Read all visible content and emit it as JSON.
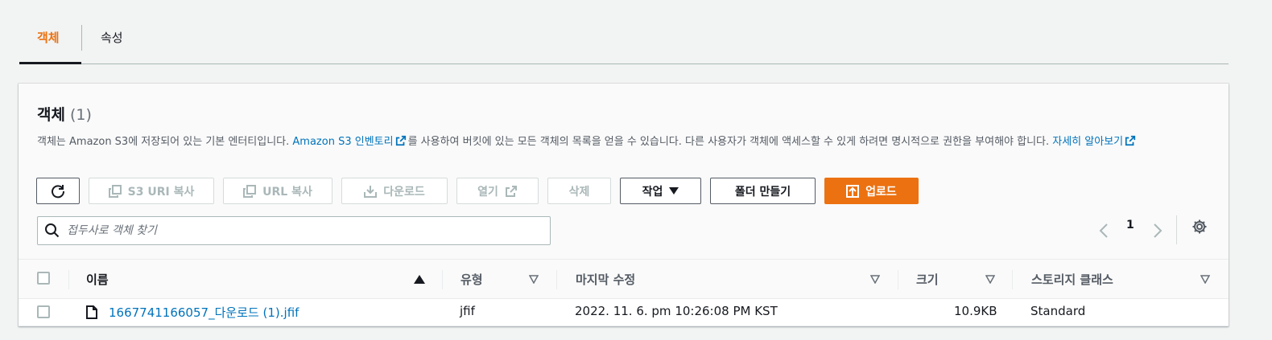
{
  "tabs": [
    {
      "label": "객체"
    },
    {
      "label": "속성"
    }
  ],
  "panel": {
    "title": "객체",
    "count": "(1)",
    "description": {
      "part1": "객체는 Amazon S3에 저장되어 있는 기본 엔터티입니다. ",
      "link1": "Amazon S3 인벤토리",
      "part2": "를 사용하여 버킷에 있는 모든 객체의 목록을 얻을 수 있습니다. 다른 사용자가 객체에 액세스할 수 있게 하려면 명시적으로 권한을 부여해야 합니다. ",
      "link2": "자세히 알아보기"
    }
  },
  "toolbar": {
    "refresh_icon": "refresh-icon",
    "copy_s3_uri": "S3 URI 복사",
    "copy_url": "URL 복사",
    "download": "다운로드",
    "open": "열기",
    "delete": "삭제",
    "actions": "작업",
    "create_folder": "폴더 만들기",
    "upload": "업로드"
  },
  "search": {
    "placeholder": "접두사로 객체 찾기",
    "value": ""
  },
  "pagination": {
    "current_page": "1"
  },
  "table": {
    "columns": [
      "이름",
      "유형",
      "마지막 수정",
      "크기",
      "스토리지 클래스"
    ],
    "rows": [
      {
        "name": "1667741166057_다운로드 (1).jfif",
        "type": "jfif",
        "last_modified": "2022. 11. 6. pm 10:26:08 PM KST",
        "size": "10.9KB",
        "storage_class": "Standard"
      }
    ]
  },
  "colors": {
    "accent": "#ec7211",
    "link": "#0073bb",
    "text": "#16191f",
    "muted": "#545b64",
    "disabled": "#aab7b8"
  }
}
